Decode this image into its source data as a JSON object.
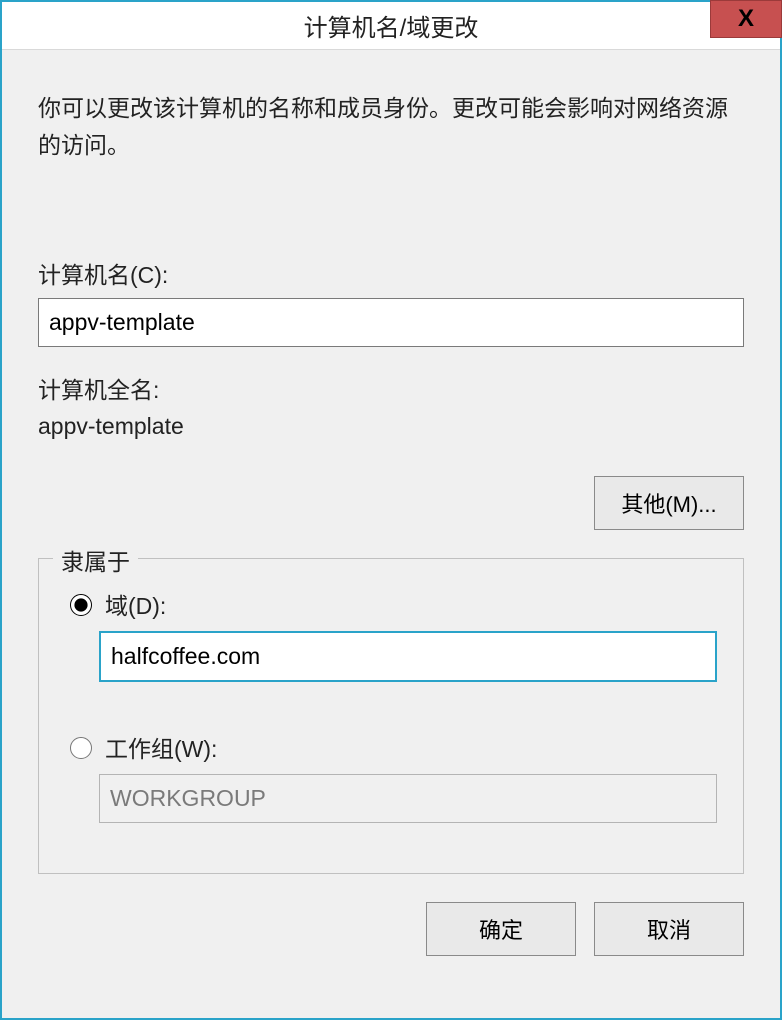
{
  "window": {
    "title": "计算机名/域更改",
    "close_symbol": "X"
  },
  "description": "你可以更改该计算机的名称和成员身份。更改可能会影响对网络资源的访问。",
  "computer_name": {
    "label": "计算机名(C):",
    "value": "appv-template"
  },
  "full_name": {
    "label": "计算机全名:",
    "value": "appv-template"
  },
  "more_button": "其他(M)...",
  "member_of": {
    "legend": "隶属于",
    "domain": {
      "label": "域(D):",
      "value": "halfcoffee.com",
      "selected": true
    },
    "workgroup": {
      "label": "工作组(W):",
      "value": "WORKGROUP",
      "selected": false
    }
  },
  "buttons": {
    "ok": "确定",
    "cancel": "取消"
  }
}
